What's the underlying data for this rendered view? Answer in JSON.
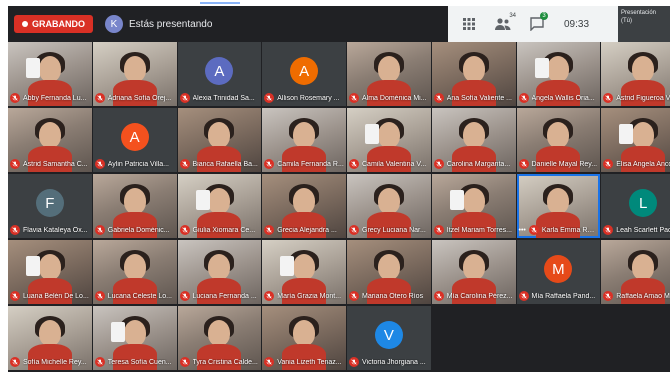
{
  "recording": {
    "label": "GRABANDO"
  },
  "presenter": {
    "avatar_letter": "K",
    "text": "Estás presentando"
  },
  "toolbar": {
    "time": "09:33",
    "people_count": "34",
    "chat_badge": "3",
    "presenter_thumb": "Presentación (Tú)"
  },
  "colors": {
    "recording": "#d93025",
    "active_border": "#1a73e8",
    "bar": "#202124"
  },
  "participants": [
    {
      "name": "Abby Fernanda Lu...",
      "type": "cam",
      "v": "v2"
    },
    {
      "name": "Adriana Sofía Orej...",
      "type": "cam",
      "v": "v4"
    },
    {
      "name": "Alexia Trinidad Sa...",
      "type": "avatar",
      "letter": "A",
      "color": "#5c6bc0"
    },
    {
      "name": "Allison Rosemary ...",
      "type": "avatar",
      "letter": "A",
      "color": "#ef6c00"
    },
    {
      "name": "Alma Doménica Mi...",
      "type": "cam",
      "v": "v1"
    },
    {
      "name": "Ana Sofía Valiente ...",
      "type": "cam",
      "v": "v3"
    },
    {
      "name": "Angela Wallis Oria...",
      "type": "cam",
      "v": "v2"
    },
    {
      "name": "Astrid Figueroa Va...",
      "type": "cam",
      "v": "v4"
    },
    {
      "name": "Astrid Samantha C...",
      "type": "cam",
      "v": "v1"
    },
    {
      "name": "Aylin Patricia Villa...",
      "type": "avatar",
      "letter": "A",
      "color": "#f4511e"
    },
    {
      "name": "Bianca Rafaella Ba...",
      "type": "cam",
      "v": "v3"
    },
    {
      "name": "Camila Fernanda R...",
      "type": "cam",
      "v": "v2"
    },
    {
      "name": "Camila Valentina V...",
      "type": "cam",
      "v": "v4"
    },
    {
      "name": "Carolina Margarita...",
      "type": "cam",
      "v": "v2"
    },
    {
      "name": "Danielle Mayal Rey...",
      "type": "cam",
      "v": "v1"
    },
    {
      "name": "Elisa Angela Anco...",
      "type": "cam",
      "v": "v3"
    },
    {
      "name": "Flavia Kataleya Ox...",
      "type": "avatar",
      "letter": "F",
      "color": "#546e7a"
    },
    {
      "name": "Gabriela Doménic...",
      "type": "cam",
      "v": "v1"
    },
    {
      "name": "Giulia Xiomara Ce...",
      "type": "cam",
      "v": "v4"
    },
    {
      "name": "Grecia Alejandra ...",
      "type": "cam",
      "v": "v3"
    },
    {
      "name": "Grecy Luciana Nar...",
      "type": "cam",
      "v": "v2"
    },
    {
      "name": "Itzel Mariam Torres...",
      "type": "cam",
      "v": "v1"
    },
    {
      "name": "Karla Emma ROJA...",
      "type": "cam",
      "v": "v4",
      "active": true,
      "more": "•••"
    },
    {
      "name": "Leah Scarlett Padi...",
      "type": "avatar",
      "letter": "L",
      "color": "#00897b"
    },
    {
      "name": "Luana Belén De Lo...",
      "type": "cam",
      "v": "v3"
    },
    {
      "name": "Lucana Celeste Lo...",
      "type": "cam",
      "v": "v1"
    },
    {
      "name": "Luciana Fernanda ...",
      "type": "cam",
      "v": "v2"
    },
    {
      "name": "María Grazia Mont...",
      "type": "cam",
      "v": "v4"
    },
    {
      "name": "Mariana Otero Ríos",
      "type": "cam",
      "v": "v3"
    },
    {
      "name": "Mía Carolina Pérez...",
      "type": "cam",
      "v": "v2"
    },
    {
      "name": "Mía Raffaela Pand...",
      "type": "avatar",
      "letter": "M",
      "color": "#e64a19"
    },
    {
      "name": "Raffaela Amao M...",
      "type": "cam",
      "v": "v1"
    },
    {
      "name": "Sofía Michelle Rey...",
      "type": "cam",
      "v": "v4"
    },
    {
      "name": "Teresa Sofía Cuen...",
      "type": "cam",
      "v": "v2"
    },
    {
      "name": "Tyra Cristina Calde...",
      "type": "cam",
      "v": "v1"
    },
    {
      "name": "Vania Lizeth Tenaz...",
      "type": "cam",
      "v": "v3"
    },
    {
      "name": "Victoria Jhorgiana ...",
      "type": "avatar",
      "letter": "V",
      "color": "#1e88e5"
    }
  ]
}
